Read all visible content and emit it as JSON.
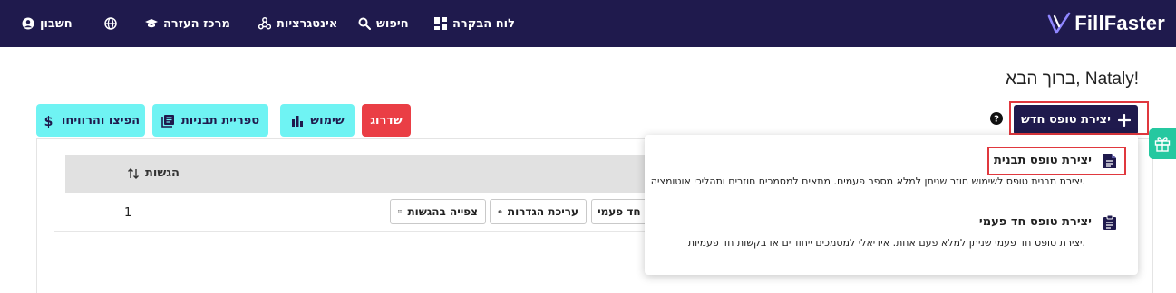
{
  "brand": {
    "name": "FillFaster"
  },
  "nav": {
    "dashboard": "לוח הבקרה",
    "search": "חיפוש",
    "integrations": "אינטגרציות",
    "help_center": "מרכז העזרה",
    "account": "חשבון"
  },
  "welcome": "ברוך הבא, Nataly!",
  "toolbar": {
    "create_new": "יצירת טופס חדש",
    "upgrade": "שדרוג",
    "usage": "שימוש",
    "template_library": "ספריית תבניות",
    "distribute_profit": "הפיצו והרוויחו"
  },
  "table": {
    "column_submissions": "הגשות",
    "row": {
      "submissions": "1",
      "view_submissions": "צפייה בהגשות",
      "edit_settings": "עריכת הגדרות",
      "one_time_partial": "ס חד פעמי"
    }
  },
  "dropdown": {
    "template_form": {
      "title": "יצירת טופס תבנית",
      "description": "יצירת תבנית טופס לשימוש חוזר שניתן למלא מספר פעמים. מתאים למסמכים חוזרים ותהליכי אוטומציה."
    },
    "one_time_form": {
      "title": "יצירת טופס חד פעמי",
      "description": "יצירת טופס חד פעמי שניתן למלא פעם אחת. אידיאלי למסמכים ייחודיים או בקשות חד פעמיות."
    }
  },
  "colors": {
    "navbar": "#1f1a4d",
    "accent_cyan": "#6ff3f3",
    "upgrade_red": "#ea3e45",
    "highlight_red": "#e0383e",
    "gift_green": "#25c8a0"
  },
  "icons": {
    "dashboard": "grid-icon",
    "search": "search-icon",
    "integrations": "webhook-icon",
    "help": "graduation-cap-icon",
    "language": "globe-icon",
    "account": "user-circle-icon"
  }
}
